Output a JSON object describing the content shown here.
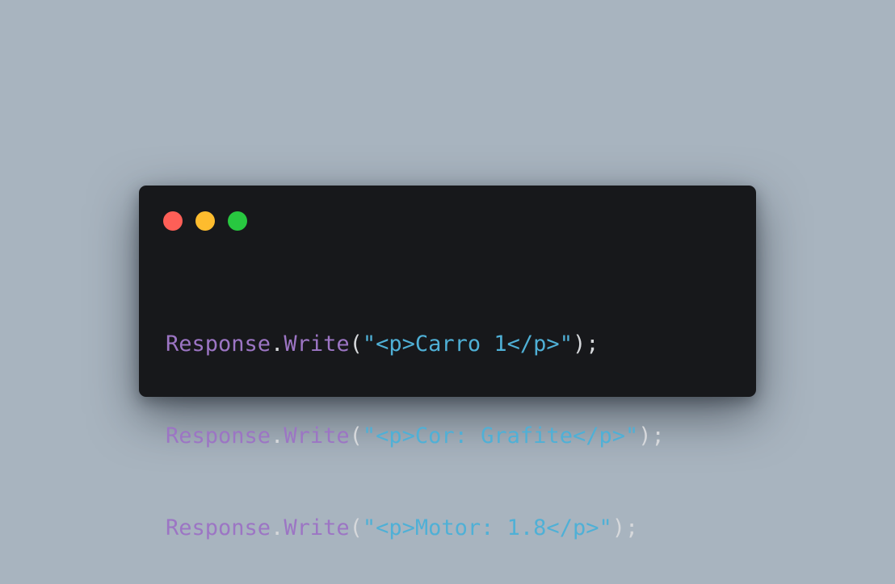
{
  "colors": {
    "background": "#a8b4bf",
    "window": "#17181b",
    "identifier": "#9c75c4",
    "punctuation": "#d6d8db",
    "string": "#4fb0d6",
    "dot_close": "#fe5f57",
    "dot_minimize": "#febc2e",
    "dot_maximize": "#28c840"
  },
  "code": {
    "lines": [
      {
        "object": "Response",
        "dot": ".",
        "method": "Write",
        "open": "(",
        "string": "\"<p>Carro 1</p>\"",
        "close": ");"
      },
      {
        "object": "Response",
        "dot": ".",
        "method": "Write",
        "open": "(",
        "string": "\"<p>Cor: Grafite</p>\"",
        "close": ");"
      },
      {
        "object": "Response",
        "dot": ".",
        "method": "Write",
        "open": "(",
        "string": "\"<p>Motor: 1.8</p>\"",
        "close": ");"
      }
    ]
  }
}
